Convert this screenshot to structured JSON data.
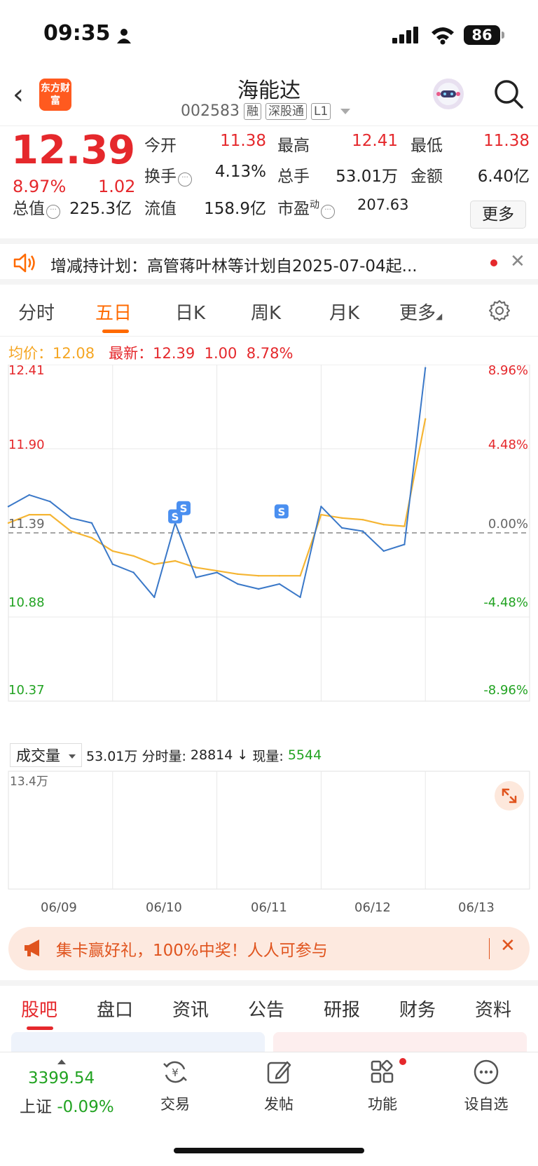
{
  "status": {
    "time": "09:35",
    "battery": "86"
  },
  "header": {
    "logo_text": "东方财富",
    "name": "海能达",
    "code": "002583",
    "tags": [
      "融",
      "深股通",
      "L1"
    ]
  },
  "quote": {
    "price": "12.39",
    "pct": "8.97%",
    "change": "1.02",
    "open_label": "今开",
    "open": "11.38",
    "high_label": "最高",
    "high": "12.41",
    "low_label": "最低",
    "low": "11.38",
    "turnover_label": "换手",
    "turnover": "4.13%",
    "volume_label": "总手",
    "volume": "53.01万",
    "amount_label": "金额",
    "amount": "6.40亿",
    "mcap_label": "总值",
    "mcap": "225.3亿",
    "float_label": "流值",
    "float": "158.9亿",
    "pe_label": "市盈",
    "pe_sup": "动",
    "pe": "207.63",
    "more": "更多"
  },
  "notice": {
    "text": "增减持计划：高管蒋叶林等计划自2025-07-04起..."
  },
  "chart_tabs": [
    "分时",
    "五日",
    "日K",
    "周K",
    "月K",
    "更多"
  ],
  "legend": {
    "avg_label": "均价：",
    "avg": "12.08",
    "latest_label": "最新：",
    "latest": "12.39",
    "latest_chg": "1.00",
    "latest_pct": "8.78%"
  },
  "volume_bar": {
    "selector": "成交量",
    "total": "53.01万",
    "tick_label": "分时量:",
    "tick_value": "28814",
    "arrow": "↓",
    "now_label": "现量:",
    "now_value": "5544",
    "vol_max": "13.4万"
  },
  "chart_data": [
    {
      "type": "line",
      "x": [
        "06/09",
        "06/10",
        "06/11",
        "06/12",
        "06/13"
      ],
      "y_ticks": [
        "12.41",
        "11.90",
        "11.39",
        "10.88",
        "10.37"
      ],
      "y_right_ticks": [
        "8.96%",
        "4.48%",
        "0.00%",
        "-4.48%",
        "-8.96%"
      ],
      "ylim": [
        10.37,
        12.41
      ],
      "reference": 11.39,
      "series": [
        {
          "values": [
            11.55,
            11.62,
            11.58,
            11.48,
            11.45,
            11.2,
            11.15,
            11.0,
            11.45,
            11.12,
            11.15,
            11.08,
            11.05,
            11.08,
            11.0,
            11.55,
            11.42,
            11.4,
            11.28,
            11.32,
            12.39
          ]
        },
        {
          "values": [
            11.45,
            11.5,
            11.5,
            11.4,
            11.36,
            11.28,
            11.25,
            11.2,
            11.22,
            11.18,
            11.16,
            11.14,
            11.13,
            11.13,
            11.13,
            11.5,
            11.48,
            11.47,
            11.44,
            11.43,
            12.08
          ]
        }
      ],
      "markers": [
        "S",
        "S",
        "S"
      ]
    },
    {
      "type": "bar",
      "x": [
        "06/09",
        "06/10",
        "06/11",
        "06/12",
        "06/13"
      ],
      "ylabel": "13.4万",
      "ylim": [
        0,
        134000
      ]
    }
  ],
  "banner": {
    "text": "集卡赢好礼，100%中奖！人人可参与"
  },
  "bottom_tabs": [
    "股吧",
    "盘口",
    "资讯",
    "公告",
    "研报",
    "财务",
    "资料"
  ],
  "toolbar": {
    "index_value": "3399.54",
    "index_name": "上证",
    "index_pct": "-0.09%",
    "items": [
      "交易",
      "发帖",
      "功能",
      "设自选"
    ]
  },
  "colors": {
    "up": "#e5282c",
    "down": "#22a322",
    "accent": "#ff6a00",
    "price_line": "#3a78c8",
    "avg_line": "#f5b533"
  }
}
